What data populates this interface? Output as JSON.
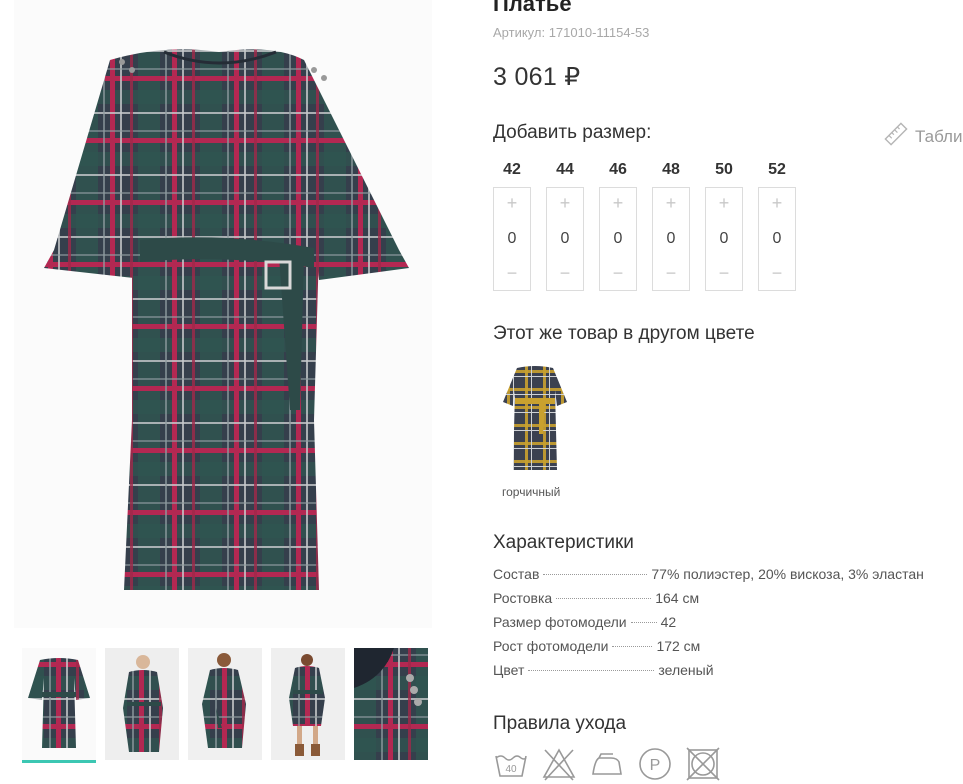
{
  "product": {
    "title": "Платье",
    "sku": "Артикул: 171010-11154-53",
    "price": "3 061 ₽"
  },
  "sizes": {
    "heading": "Добавить размер:",
    "table_link": "Табли",
    "plus": "+",
    "minus": "−",
    "items": [
      {
        "label": "42",
        "qty": "0"
      },
      {
        "label": "44",
        "qty": "0"
      },
      {
        "label": "46",
        "qty": "0"
      },
      {
        "label": "48",
        "qty": "0"
      },
      {
        "label": "50",
        "qty": "0"
      },
      {
        "label": "52",
        "qty": "0"
      }
    ]
  },
  "other_color": {
    "heading": "Этот же товар в другом цвете",
    "name": "горчичный"
  },
  "characteristics": {
    "heading": "Характеристики",
    "rows": [
      {
        "key": "Состав",
        "value": "77% полиэстер, 20% вискоза, 3% эластан"
      },
      {
        "key": "Ростовка",
        "value": "164 см"
      },
      {
        "key": "Размер фотомодели",
        "value": "42"
      },
      {
        "key": "Рост фотомодели",
        "value": "172 см"
      },
      {
        "key": "Цвет",
        "value": "зеленый"
      }
    ]
  },
  "care": {
    "heading": "Правила ухода",
    "wash_temp": "40",
    "no_iron_label": "P",
    "icons": [
      "wash-40-icon",
      "no-bleach-icon",
      "iron-icon",
      "dry-clean-p-icon",
      "no-tumble-dry-icon"
    ]
  },
  "colors": {
    "accent": "#3cc7b3",
    "plaid_base": "#3a4a4e",
    "plaid_red": "#b0284f",
    "plaid_green": "#2f5a4e",
    "belt": "#2d4a48",
    "mustard_belt": "#c9a12f"
  }
}
